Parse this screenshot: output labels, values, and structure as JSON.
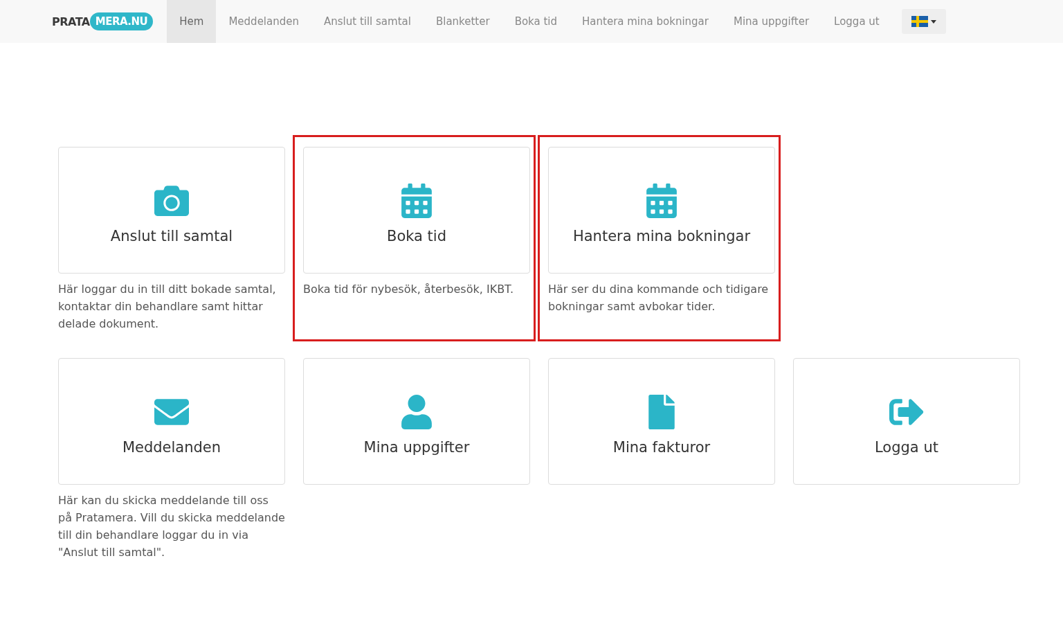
{
  "logo": {
    "part_1": "PRATA",
    "part_2": "MERA.NU"
  },
  "nav": [
    {
      "label": "Hem",
      "selected": true
    },
    {
      "label": "Meddelanden",
      "selected": false
    },
    {
      "label": "Anslut till samtal",
      "selected": false
    },
    {
      "label": "Blanketter",
      "selected": false
    },
    {
      "label": "Boka tid",
      "selected": false
    },
    {
      "label": "Hantera mina bokningar",
      "selected": false
    },
    {
      "label": "Mina uppgifter",
      "selected": false
    },
    {
      "label": "Logga ut",
      "selected": false
    }
  ],
  "tiles": [
    {
      "title": "Anslut till samtal",
      "description": "Här loggar du in till ditt bokade samtal, kontaktar din behandlare samt hittar delade dokument.",
      "highlighted": false
    },
    {
      "title": "Boka tid",
      "description": "Boka tid för nybesök, återbesök, IKBT.",
      "highlighted": true
    },
    {
      "title": "Hantera mina bokningar",
      "description": "Här ser du dina kommande och tidigare bokningar samt avbokar tider.",
      "highlighted": true
    },
    {
      "title": "Meddelanden",
      "description": "Här kan du skicka meddelande till oss på Pratamera. Vill du skicka meddelande till din behandlare loggar du in via \"Anslut till samtal\".",
      "highlighted": false
    },
    {
      "title": "Mina uppgifter",
      "highlighted": false
    },
    {
      "title": "Mina fakturor",
      "highlighted": false
    },
    {
      "title": "Logga ut",
      "highlighted": false
    }
  ]
}
